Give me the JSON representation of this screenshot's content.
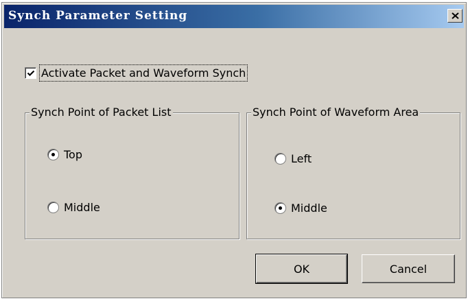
{
  "window": {
    "title": "Synch Parameter Setting",
    "close_glyph": "close-icon"
  },
  "options": {
    "activate_label": "Activate Packet and Waveform Synch",
    "activate_checked": true
  },
  "packet_group": {
    "title": "Synch Point of Packet List",
    "options": [
      {
        "label": "Top",
        "selected": true
      },
      {
        "label": "Middle",
        "selected": false
      }
    ]
  },
  "waveform_group": {
    "title": "Synch Point of Waveform Area",
    "options": [
      {
        "label": "Left",
        "selected": false
      },
      {
        "label": "Middle",
        "selected": true
      }
    ]
  },
  "buttons": {
    "ok_label": "OK",
    "cancel_label": "Cancel"
  },
  "colors": {
    "title_gradient_start": "#0a246a",
    "title_gradient_end": "#a6caf0",
    "dialog_face": "#d4d0c8"
  }
}
